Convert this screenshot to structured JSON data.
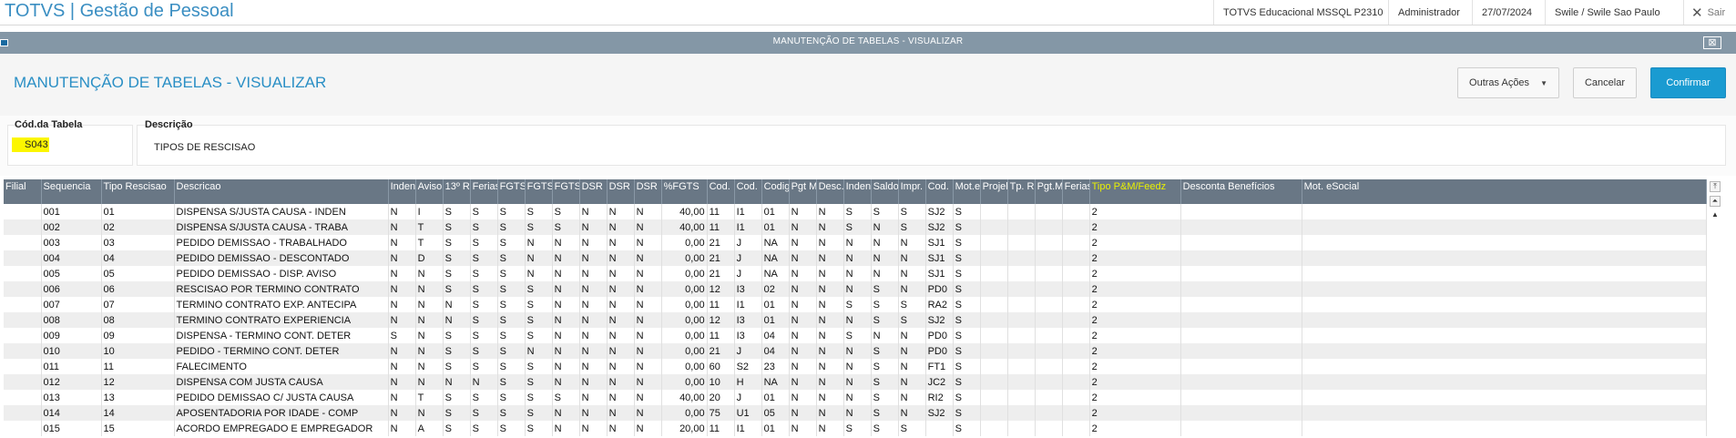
{
  "app": {
    "title": "TOTVS | Gestão de Pessoal",
    "environment": "TOTVS Educacional MSSQL P2310",
    "user": "Administrador",
    "date": "27/07/2024",
    "company": "Swile / Swile Sao Paulo",
    "logout": "Sair"
  },
  "window": {
    "title": "MANUTENÇÃO DE TABELAS - VISUALIZAR"
  },
  "page": {
    "title": "MANUTENÇÃO DE TABELAS - VISUALIZAR",
    "actions": {
      "more": "Outras Ações",
      "cancel": "Cancelar",
      "confirm": "Confirmar"
    }
  },
  "form": {
    "code_label": "Cód.da Tabela",
    "code_value": "S043",
    "desc_label": "Descrição",
    "desc_value": "TIPOS DE RESCISAO"
  },
  "grid": {
    "columns": [
      "Filial",
      "Sequencia",
      "Tipo Rescisao",
      "Descricao",
      "Inden",
      "Aviso",
      "13º R",
      "Ferias",
      "FGTS",
      "FGTS",
      "FGTS",
      "DSR",
      "DSR",
      "DSR",
      "%FGTS",
      "Cod.",
      "Cod.",
      "Codig",
      "Pgt M",
      "Desc.",
      "Inden",
      "Saldo",
      "Impr.",
      "Cod.",
      "Mot.e",
      "Projel",
      "Tp. R",
      "Pgt.M",
      "Ferias",
      "Tipo P&M/Feedz",
      "Desconta Benefícios",
      "Mot. eSocial"
    ],
    "highlight_column": "Tipo P&M/Feedz",
    "rows": [
      [
        "",
        "001",
        "01",
        "DISPENSA S/JUSTA CAUSA - INDEN",
        "N",
        "I",
        "S",
        "S",
        "S",
        "S",
        "S",
        "N",
        "N",
        "N",
        "40,00",
        "11",
        "I1",
        "01",
        "N",
        "N",
        "S",
        "S",
        "S",
        "SJ2",
        "S",
        "",
        "",
        "",
        "",
        "2",
        "",
        ""
      ],
      [
        "",
        "002",
        "02",
        "DISPENSA S/JUSTA CAUSA - TRABA",
        "N",
        "T",
        "S",
        "S",
        "S",
        "S",
        "S",
        "N",
        "N",
        "N",
        "40,00",
        "11",
        "I1",
        "01",
        "N",
        "N",
        "S",
        "N",
        "S",
        "SJ2",
        "S",
        "",
        "",
        "",
        "",
        "2",
        "",
        ""
      ],
      [
        "",
        "003",
        "03",
        "PEDIDO DEMISSAO - TRABALHADO",
        "N",
        "T",
        "S",
        "S",
        "S",
        "N",
        "N",
        "N",
        "N",
        "N",
        "0,00",
        "21",
        "J",
        "NA",
        "N",
        "N",
        "N",
        "N",
        "N",
        "SJ1",
        "S",
        "",
        "",
        "",
        "",
        "2",
        "",
        ""
      ],
      [
        "",
        "004",
        "04",
        "PEDIDO DEMISSAO - DESCONTADO",
        "N",
        "D",
        "S",
        "S",
        "S",
        "N",
        "N",
        "N",
        "N",
        "N",
        "0,00",
        "21",
        "J",
        "NA",
        "N",
        "N",
        "N",
        "N",
        "N",
        "SJ1",
        "S",
        "",
        "",
        "",
        "",
        "2",
        "",
        ""
      ],
      [
        "",
        "005",
        "05",
        "PEDIDO DEMISSAO - DISP. AVISO",
        "N",
        "N",
        "S",
        "S",
        "S",
        "N",
        "N",
        "N",
        "N",
        "N",
        "0,00",
        "21",
        "J",
        "NA",
        "N",
        "N",
        "N",
        "N",
        "N",
        "SJ1",
        "S",
        "",
        "",
        "",
        "",
        "2",
        "",
        ""
      ],
      [
        "",
        "006",
        "06",
        "RESCISAO POR TERMINO CONTRATO",
        "N",
        "N",
        "S",
        "S",
        "S",
        "S",
        "N",
        "N",
        "N",
        "N",
        "0,00",
        "12",
        "I3",
        "02",
        "N",
        "N",
        "N",
        "S",
        "N",
        "PD0",
        "S",
        "",
        "",
        "",
        "",
        "2",
        "",
        ""
      ],
      [
        "",
        "007",
        "07",
        "TERMINO CONTRATO EXP. ANTECIPA",
        "N",
        "N",
        "N",
        "S",
        "S",
        "S",
        "N",
        "N",
        "N",
        "N",
        "0,00",
        "11",
        "I1",
        "01",
        "N",
        "N",
        "S",
        "S",
        "S",
        "RA2",
        "S",
        "",
        "",
        "",
        "",
        "2",
        "",
        ""
      ],
      [
        "",
        "008",
        "08",
        "TERMINO CONTRATO EXPERIENCIA",
        "N",
        "N",
        "N",
        "S",
        "S",
        "S",
        "N",
        "N",
        "N",
        "N",
        "0,00",
        "12",
        "I3",
        "01",
        "N",
        "N",
        "N",
        "S",
        "S",
        "SJ2",
        "S",
        "",
        "",
        "",
        "",
        "2",
        "",
        ""
      ],
      [
        "",
        "009",
        "09",
        "DISPENSA - TERMINO CONT. DETER",
        "S",
        "N",
        "S",
        "S",
        "S",
        "S",
        "N",
        "N",
        "N",
        "N",
        "0,00",
        "11",
        "I3",
        "04",
        "N",
        "N",
        "S",
        "N",
        "N",
        "PD0",
        "S",
        "",
        "",
        "",
        "",
        "2",
        "",
        ""
      ],
      [
        "",
        "010",
        "10",
        "PEDIDO - TERMINO CONT. DETER",
        "N",
        "N",
        "S",
        "S",
        "S",
        "N",
        "N",
        "N",
        "N",
        "N",
        "0,00",
        "21",
        "J",
        "04",
        "N",
        "N",
        "N",
        "S",
        "N",
        "PD0",
        "S",
        "",
        "",
        "",
        "",
        "2",
        "",
        ""
      ],
      [
        "",
        "011",
        "11",
        "FALECIMENTO",
        "N",
        "N",
        "S",
        "S",
        "S",
        "S",
        "N",
        "N",
        "N",
        "N",
        "0,00",
        "60",
        "S2",
        "23",
        "N",
        "N",
        "N",
        "S",
        "N",
        "FT1",
        "S",
        "",
        "",
        "",
        "",
        "2",
        "",
        ""
      ],
      [
        "",
        "012",
        "12",
        "DISPENSA COM JUSTA CAUSA",
        "N",
        "N",
        "N",
        "N",
        "S",
        "S",
        "N",
        "N",
        "N",
        "N",
        "0,00",
        "10",
        "H",
        "NA",
        "N",
        "N",
        "N",
        "S",
        "N",
        "JC2",
        "S",
        "",
        "",
        "",
        "",
        "2",
        "",
        ""
      ],
      [
        "",
        "013",
        "13",
        "PEDIDO DEMISSAO C/ JUSTA CAUSA",
        "N",
        "T",
        "S",
        "S",
        "S",
        "S",
        "S",
        "N",
        "N",
        "N",
        "40,00",
        "20",
        "J",
        "01",
        "N",
        "N",
        "N",
        "S",
        "N",
        "RI2",
        "S",
        "",
        "",
        "",
        "",
        "2",
        "",
        ""
      ],
      [
        "",
        "014",
        "14",
        "APOSENTADORIA POR IDADE - COMP",
        "N",
        "N",
        "S",
        "S",
        "S",
        "S",
        "N",
        "N",
        "N",
        "N",
        "0,00",
        "75",
        "U1",
        "05",
        "N",
        "N",
        "N",
        "S",
        "N",
        "SJ2",
        "S",
        "",
        "",
        "",
        "",
        "2",
        "",
        ""
      ],
      [
        "",
        "015",
        "15",
        "ACORDO EMPREGADO E EMPREGADOR",
        "N",
        "A",
        "S",
        "S",
        "S",
        "S",
        "N",
        "N",
        "N",
        "N",
        "20,00",
        "11",
        "I1",
        "01",
        "N",
        "N",
        "S",
        "S",
        "S",
        "",
        "S",
        "",
        "",
        "",
        "",
        "2",
        "",
        ""
      ]
    ]
  }
}
